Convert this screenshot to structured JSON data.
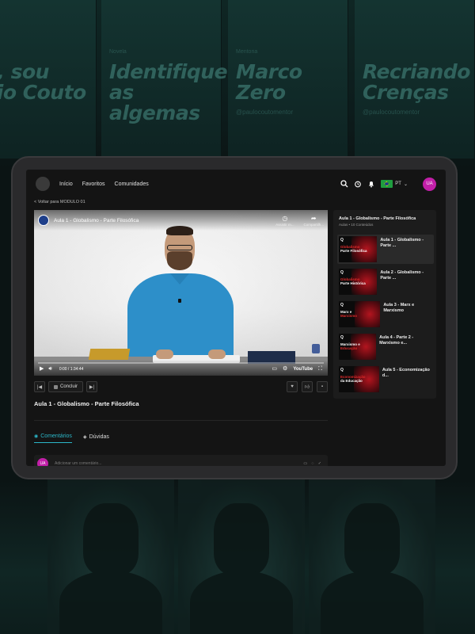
{
  "background": {
    "posters": [
      {
        "label": "",
        "title": "a, sou\nvio Couto",
        "handle": ""
      },
      {
        "label": "Novela",
        "title": "Identifique\nas algemas",
        "handle": ""
      },
      {
        "label": "Mentoria",
        "title": "Marco\nZero",
        "handle": "@paulocoutomentor"
      },
      {
        "label": "",
        "title": "Recriando\nCrenças",
        "handle": "@paulocoutomentor"
      }
    ]
  },
  "nav": {
    "links": [
      "Início",
      "Favoritos",
      "Comunidades"
    ],
    "lang": "PT",
    "avatar": "UA"
  },
  "back_link": "< Voltar para MODULO 01",
  "video": {
    "title": "Aula 1 - Globalismo - Parte Filosófica",
    "watch_later": "Assistir m...",
    "share": "Compartilh...",
    "time": "0:00 / 1:34:44",
    "progress_fraction": 0.0,
    "youtube": "YouTube"
  },
  "controls": {
    "prev": "|◀",
    "conclude": "Concluir",
    "next": "▶|"
  },
  "lesson_title": "Aula 1 - Globalismo - Parte Filosófica",
  "tabs": [
    {
      "label": "Comentários",
      "active": true
    },
    {
      "label": "Dúvidas",
      "active": false
    }
  ],
  "comment": {
    "avatar": "UA",
    "placeholder": "Adicionar um comentário..."
  },
  "sidebar": {
    "title": "Aula 1 - Globalismo - Parte Filosófica",
    "subtitle": "Aulas • 10 Conteúdos",
    "lessons": [
      {
        "name": "Aula 1 - Globalismo - Parte ...",
        "thumb_line1": "Globalismo",
        "thumb_line2": "Parte Filosófica",
        "active": true
      },
      {
        "name": "Aula 2 - Globalismo - Parte ...",
        "thumb_line1": "Globalismo",
        "thumb_line2": "Parte Histórica",
        "active": false
      },
      {
        "name": "Aula 3 - Marx e Marxismo",
        "thumb_line1": "Marx e",
        "thumb_line2": "Marxismo",
        "active": false
      },
      {
        "name": "Aula 4 - Parte 2 - Marxismo e...",
        "thumb_line1": "Marxismo e",
        "thumb_line2": "Educação",
        "active": false
      },
      {
        "name": "Aula 5 - Economização d...",
        "thumb_line1": "Economização",
        "thumb_line2": "da Educação",
        "active": false
      }
    ]
  },
  "colors": {
    "accent": "#2bb7c9",
    "avatar": "#c21fa8",
    "progress": "#e00000"
  }
}
